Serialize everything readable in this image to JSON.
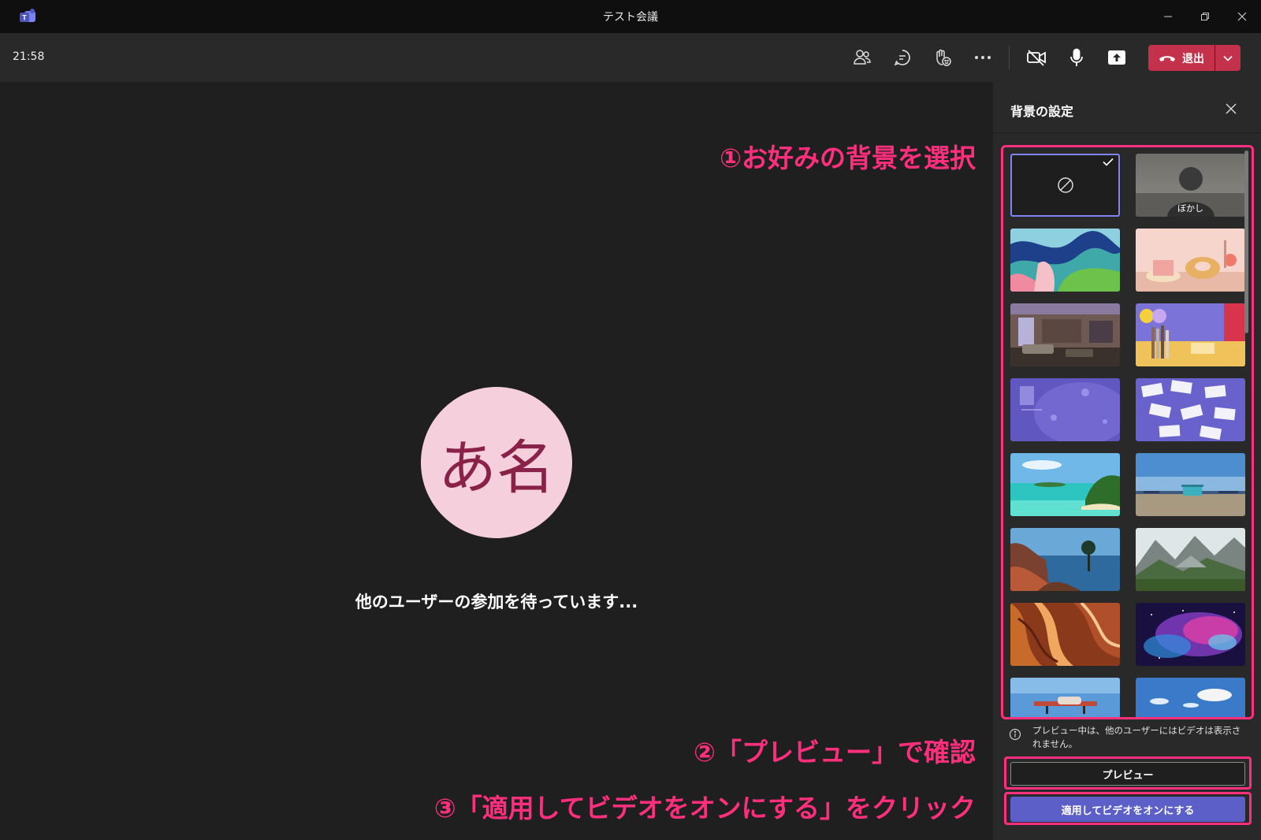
{
  "window": {
    "title": "テスト会議",
    "app_icon": "teams-logo-icon"
  },
  "toolbar": {
    "time": "21:58",
    "buttons": [
      "people-icon",
      "chat-icon",
      "react-icon",
      "more-icon",
      "camera-off-icon",
      "mic-icon",
      "share-screen-icon"
    ],
    "leave_label": "退出",
    "leave_color": "#c4314b"
  },
  "stage": {
    "avatar_initials": "あ名",
    "avatar_bg": "#f5cfdc",
    "avatar_fg": "#8a2148",
    "waiting_text": "他のユーザーの参加を待っています..."
  },
  "annotations": {
    "step1": "①お好みの背景を選択",
    "step2": "②「プレビュー」で確認",
    "step3": "③「適用してビデオをオンにする」をクリック",
    "color": "#ff2f7e"
  },
  "panel": {
    "title": "背景の設定",
    "backgrounds": [
      {
        "name": "none",
        "selected": true
      },
      {
        "name": "blur",
        "label": "ぼかし"
      },
      {
        "name": "abstract-waves"
      },
      {
        "name": "cake-scene"
      },
      {
        "name": "living-room"
      },
      {
        "name": "purple-shelves"
      },
      {
        "name": "purple-texture"
      },
      {
        "name": "scattered-cards"
      },
      {
        "name": "tropical-beach"
      },
      {
        "name": "beach-pier"
      },
      {
        "name": "rocky-coast"
      },
      {
        "name": "mountain-valley"
      },
      {
        "name": "red-canyon"
      },
      {
        "name": "nebula"
      },
      {
        "name": "sky-plane"
      },
      {
        "name": "blue-sky-clouds"
      }
    ],
    "info_text": "プレビュー中は、他のユーザーにはビデオは表示されません。",
    "preview_label": "プレビュー",
    "apply_label": "適用してビデオをオンにする",
    "accent": "#5b5fc7"
  }
}
